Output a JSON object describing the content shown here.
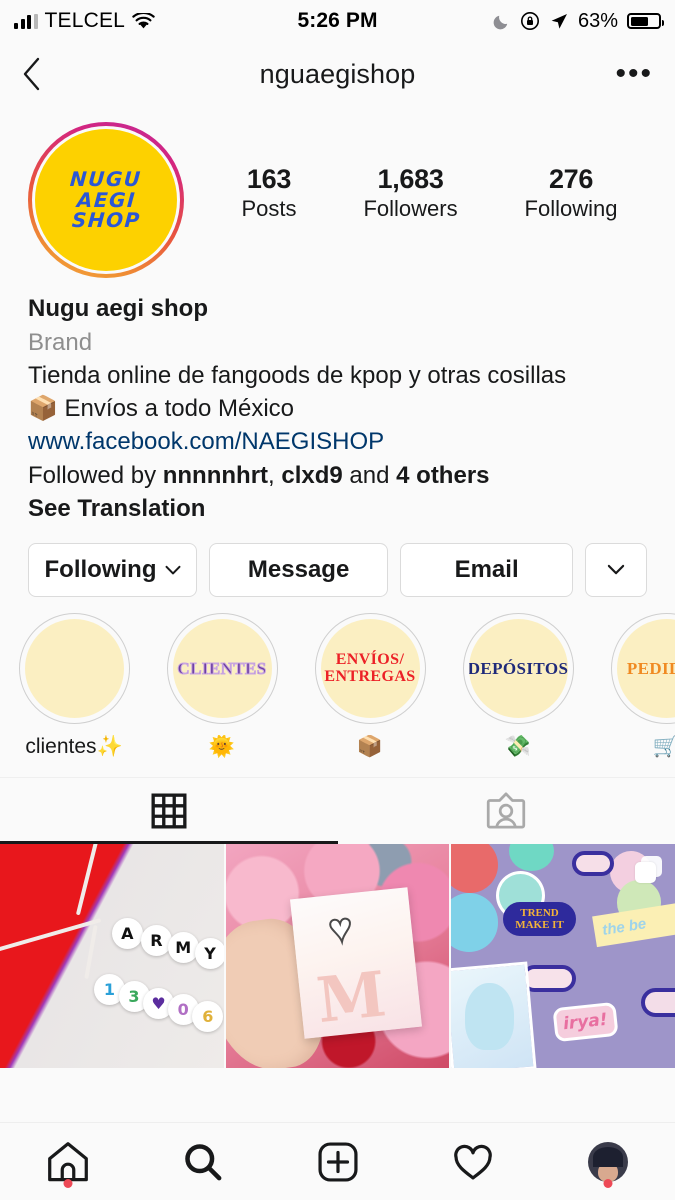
{
  "status_bar": {
    "carrier": "TELCEL",
    "time": "5:26 PM",
    "battery_percent": "63%",
    "icons": [
      "signal-bars-icon",
      "wifi-icon",
      "moon-icon",
      "rotation-lock-icon",
      "location-arrow-icon",
      "battery-icon"
    ]
  },
  "nav": {
    "back_icon": "chevron-left-icon",
    "title": "nguaegishop",
    "more_icon": "ellipsis-icon",
    "more_label": "•••"
  },
  "profile": {
    "avatar_lines": [
      "NUGU",
      "AEGI",
      "SHOP"
    ],
    "avatar_bg": "#fdd100",
    "avatar_text_color": "#2b57d6",
    "ring_gradient_from": "#c0289c",
    "ring_gradient_to": "#f5a445",
    "stats": [
      {
        "value": "163",
        "label": "Posts"
      },
      {
        "value": "1,683",
        "label": "Followers"
      },
      {
        "value": "276",
        "label": "Following"
      }
    ]
  },
  "bio": {
    "name": "Nugu aegi shop",
    "category": "Brand",
    "line1": "Tienda online de fangoods de kpop y otras cosillas",
    "line2": "📦 Envíos a todo México",
    "link": "www.facebook.com/NAEGISHOP",
    "followed_by_prefix": "Followed by ",
    "followed_by_user1": "nnnnnhrt",
    "followed_by_sep": ", ",
    "followed_by_user2": "clxd9",
    "followed_by_mid": " and ",
    "followed_by_others": "4 others",
    "see_translation": "See Translation"
  },
  "actions": {
    "following": "Following",
    "message": "Message",
    "email": "Email",
    "dropdown_icon": "chevron-down-icon"
  },
  "highlights": [
    {
      "label": "clientes✨",
      "cover_text": "",
      "cover_text2": "",
      "text_color": ""
    },
    {
      "label": "🌞",
      "cover_text": "CLIENTES",
      "cover_text2": "",
      "text_color": "#6b3fa0"
    },
    {
      "label": "📦",
      "cover_text": "ENVÍOS/",
      "cover_text2": "ENTREGAS",
      "text_color": "#ec2127"
    },
    {
      "label": "💸",
      "cover_text": "DEPÓSITOS",
      "cover_text2": "",
      "text_color": "#1f2a7a"
    },
    {
      "label": "🛒",
      "cover_text": "PEDIDOS",
      "cover_text2": "",
      "text_color": "#f08a22"
    }
  ],
  "tabs": [
    {
      "name": "grid-tab",
      "icon": "grid-icon",
      "active": true
    },
    {
      "name": "tagged-tab",
      "icon": "tagged-person-icon",
      "active": false
    }
  ],
  "posts": [
    {
      "description": "ARMY beaded bracelet on red and white background",
      "beads_top": [
        "A",
        "R",
        "M",
        "Y"
      ],
      "beads_bottom": [
        "1",
        "3",
        "♥",
        "0",
        "6"
      ],
      "multi": false
    },
    {
      "description": "Hand holding card with heart pendant over pink lilies and red roses",
      "card_letter": "M",
      "multi": false
    },
    {
      "description": "Sticker sheet collection on purple background",
      "sticker_texts": [
        "TREND MAKE IT",
        "the be",
        "irya!"
      ],
      "multi": true
    }
  ],
  "bottom_nav": [
    {
      "name": "home-icon",
      "badge": true
    },
    {
      "name": "search-icon",
      "badge": false
    },
    {
      "name": "add-post-icon",
      "badge": false
    },
    {
      "name": "activity-heart-icon",
      "badge": false
    },
    {
      "name": "profile-avatar",
      "badge": true
    }
  ]
}
